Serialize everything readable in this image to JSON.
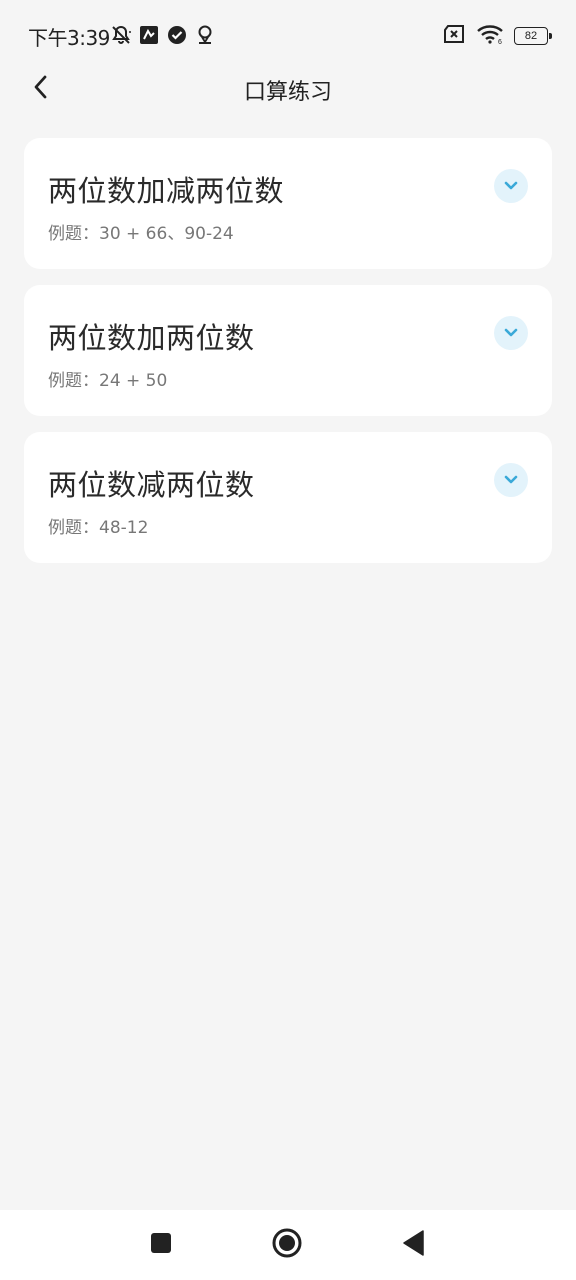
{
  "status_bar": {
    "time": "下午3:39",
    "battery_level": "82",
    "icons": [
      "notifications-off-icon",
      "app-notification-icon",
      "check-badge-icon",
      "location-icon",
      "sim-error-icon",
      "wifi-icon",
      "battery-icon"
    ]
  },
  "header": {
    "title": "口算练习",
    "back_icon": "chevron-left-icon"
  },
  "exercises": [
    {
      "title": "两位数加减两位数",
      "example": "例题：30 + 66、90-24"
    },
    {
      "title": "两位数加两位数",
      "example": "例题：24 + 50"
    },
    {
      "title": "两位数减两位数",
      "example": "例题：48-12"
    }
  ],
  "navigation": {
    "buttons": [
      "recents-square-icon",
      "home-circle-icon",
      "back-triangle-icon"
    ]
  },
  "colors": {
    "background": "#f5f5f5",
    "card": "#ffffff",
    "accent": "#3aa9d8",
    "accent_bg": "#e3f3fb"
  }
}
